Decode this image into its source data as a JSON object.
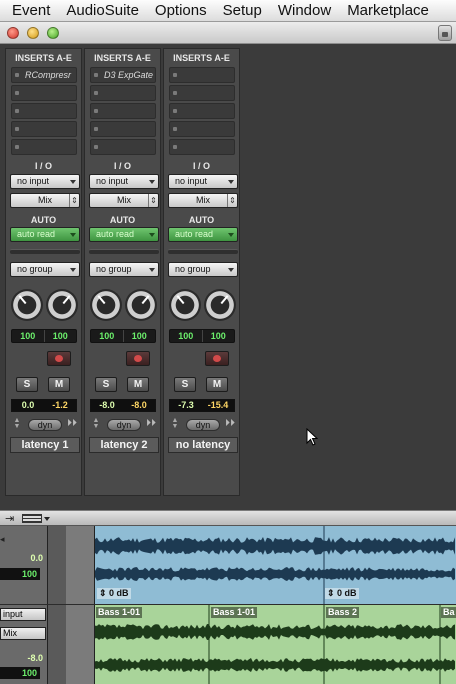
{
  "menu": [
    "Event",
    "AudioSuite",
    "Options",
    "Setup",
    "Window",
    "Marketplace"
  ],
  "strips": [
    {
      "inserts_title": "INSERTS A-E",
      "inserts": [
        "RCompresr",
        "",
        "",
        "",
        ""
      ],
      "io_title": "I / O",
      "input": "no input",
      "output": "Mix",
      "auto_title": "AUTO",
      "auto_mode": "auto read",
      "group": "no group",
      "pan_left": "100",
      "pan_right": "100",
      "solo": "S",
      "mute": "M",
      "volume": "0.0",
      "peak": "-1.2",
      "dyn": "dyn",
      "name": "latency 1"
    },
    {
      "inserts_title": "INSERTS A-E",
      "inserts": [
        "D3 ExpGate",
        "",
        "",
        "",
        ""
      ],
      "io_title": "I / O",
      "input": "no input",
      "output": "Mix",
      "auto_title": "AUTO",
      "auto_mode": "auto read",
      "group": "no group",
      "pan_left": "100",
      "pan_right": "100",
      "solo": "S",
      "mute": "M",
      "volume": "-8.0",
      "peak": "-8.0",
      "dyn": "dyn",
      "name": "latency 2"
    },
    {
      "inserts_title": "INSERTS A-E",
      "inserts": [
        "",
        "",
        "",
        "",
        ""
      ],
      "io_title": "I / O",
      "input": "no input",
      "output": "Mix",
      "auto_title": "AUTO",
      "auto_mode": "auto read",
      "group": "no group",
      "pan_left": "100",
      "pan_right": "100",
      "solo": "S",
      "mute": "M",
      "volume": "-7.3",
      "peak": "-15.4",
      "dyn": "dyn",
      "name": "no latency"
    }
  ],
  "edit": {
    "track1": {
      "volume": "0.0",
      "pan": "100",
      "clip_gain": [
        "0 dB",
        "0 dB"
      ]
    },
    "track2": {
      "input": "input",
      "output": "Mix",
      "volume": "-8.0",
      "pan": "100",
      "clips": [
        "Bass 1-01",
        "Bass 1-01",
        "Bass 2",
        "Ba"
      ]
    }
  },
  "colors": {
    "track1_wave_bg": "#8fbcd4",
    "track1_wave": "#1d3a52",
    "track2_wave_bg": "#a9d49a",
    "track2_wave": "#1d3b1a",
    "meter_green": "#6cf06c"
  }
}
